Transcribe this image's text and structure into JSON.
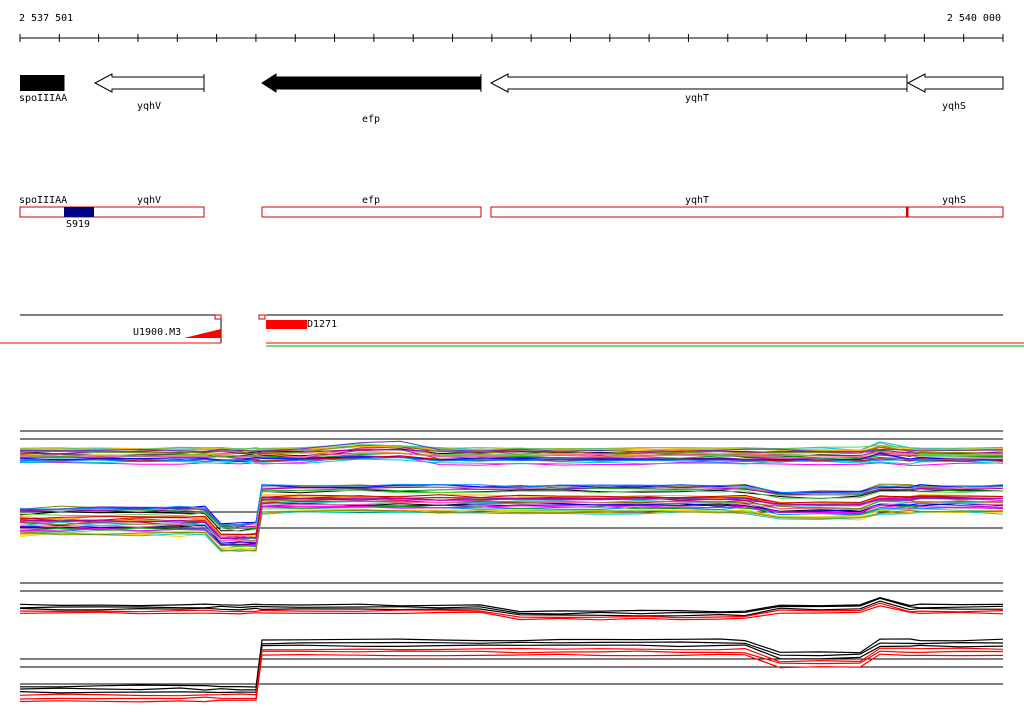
{
  "ruler": {
    "start_label": "2 537 501",
    "end_label": "2 540 000"
  },
  "genes_arrows": [
    {
      "name": "spoIIIAA",
      "strand": "-",
      "filled": true
    },
    {
      "name": "yqhV",
      "strand": "-",
      "filled": false
    },
    {
      "name": "efp",
      "strand": "-",
      "filled": true
    },
    {
      "name": "yqhT",
      "strand": "-",
      "filled": false
    },
    {
      "name": "yqhS",
      "strand": "-",
      "filled": false
    }
  ],
  "gene_boxes": [
    {
      "name": "spoIIIAA"
    },
    {
      "name": "yqhV"
    },
    {
      "name": "efp"
    },
    {
      "name": "yqhT"
    },
    {
      "name": "yqhS"
    }
  ],
  "features": {
    "s919": "S919",
    "u1900": "U1900.M3",
    "d1271": "D1271"
  },
  "colors": {
    "gene_outline": "#cc0000",
    "highlight_box": "#000080",
    "red_feature": "#ff0000",
    "green_line": "#00aa00"
  }
}
